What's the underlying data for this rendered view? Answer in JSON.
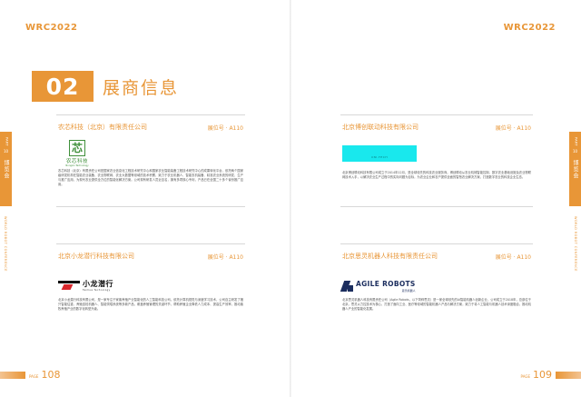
{
  "brand": "WRC2022",
  "side_tab": {
    "part_label": "PART",
    "part_number": "10",
    "section_cn": "博览会"
  },
  "vertical_label": "WORLD ROBOT CONFERENCE",
  "page_label": "PAGE",
  "pages": {
    "left_number": "108",
    "right_number": "109"
  },
  "section": {
    "number": "02",
    "title": "展商信息"
  },
  "exhibitors": [
    {
      "company": "农芯科技（北京）有限责任公司",
      "booth": "展位号 · A110",
      "logo": {
        "mark": "芯",
        "name": "农芯科技",
        "sub": "Nongxin Technology"
      },
      "description": "农芯科技（北京）有限责任公司是国家农业信息化工程技术研究中心和国家农业智能装备工程技术研究中心的成果转化平台，依托两个国家级研发机构在智能农业装备、农业物联网、农业大数据等领域的技术积累，致力于农业机器人、智能农机装备、精准农业系统的研发、生产与推广应用，为现代农业提供全方位的智能化解决方案。公司现有研发人员近百名，拥有多项核心专利，产品已在全国二十多个省份推广应用。"
    },
    {
      "company": "北京博创联动科技有限公司",
      "booth": "展位号 · A110",
      "logo": {
        "text": "UNI-TECH"
      },
      "description": "北京博创联动科技有限公司成立于2014年12月，是全球领先的科技农业服务商。博创联动从农业机械智能控制、数字农业基础设施及农业物联网技术入手，以解决农业生产过程中的实际问题为目标，为农业企业和农户提供全面的智慧农业解决方案，打造数字农业的科技企业生态。"
    },
    {
      "company": "北京小龙潜行科技有限公司",
      "booth": "展位号 · A110",
      "logo": {
        "name": "小龙潜行",
        "sub": "Tanhua Technology"
      },
      "description": "北京小龙潜行科技有限公司，是一家专注于家畜养殖产业智能化的人工智能科技公司。依托计算机视觉与深度学习技术，公司自主研发了猪只智能估重、养殖巡检机器人、智能饲喂系统等多款产品，覆盖养殖管理的关键环节，帮助养殖企业降低人力成本、提高生产效率，推动畜牧养殖产业的数字化转型升级。"
    },
    {
      "company": "北京思灵机器人科技有限责任公司",
      "booth": "展位号 · A110",
      "logo": {
        "name": "AGILE ROBOTS",
        "sub": "思灵机器人"
      },
      "description": "北京思灵机器人科技有限责任公司（Agile Robots，以下简称思灵）是一家全球领先的AI智能机器人创新企业，公司成立于2018年，总部位于北京。思灵以力控技术为核心，打造了面向工业、医疗等领域的智能机器人产品与解决方案，致力于将人工智能与机器人技术深度融合，推动机器人产业的智能化发展。"
    }
  ]
}
